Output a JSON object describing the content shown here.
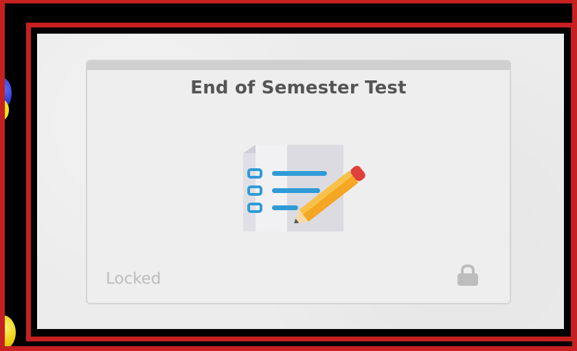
{
  "card": {
    "title": "End of Semester Test",
    "status": "Locked",
    "icon": "test-checklist-pencil-icon",
    "status_icon": "lock-icon"
  },
  "colors": {
    "frame_red": "#c62020",
    "background_black": "#000000",
    "paper": "#ececec",
    "card_border": "#d4d4d4",
    "card_topbar": "#cfcfcf",
    "title_text": "#555555",
    "status_text": "#bdbdbd",
    "checklist_blue": "#2f9bd6",
    "pencil_orange": "#f5a623",
    "pencil_red": "#e0403a"
  }
}
